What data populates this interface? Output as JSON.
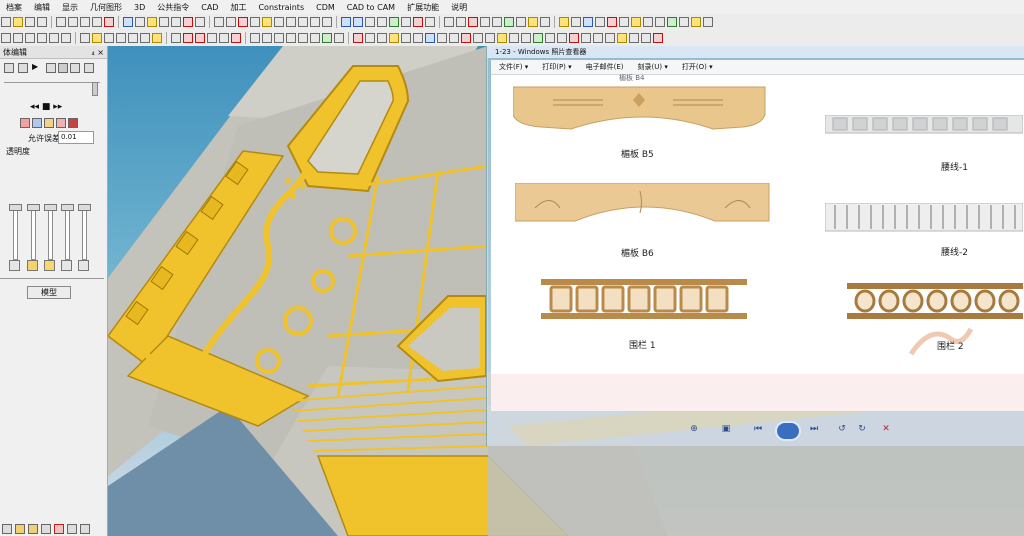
{
  "menu": [
    "档案",
    "编辑",
    "显示",
    "几何图形",
    "3D",
    "公共指令",
    "CAD",
    "加工",
    "Constraints",
    "CDM",
    "CAD to CAM",
    "扩展功能",
    "说明"
  ],
  "panel": {
    "title": "体编辑",
    "pin": "₄",
    "close": "×",
    "tolerance_label": "允许误差",
    "tolerance_value": "0.01",
    "transparency_label": "透明度",
    "apply_button": "模型"
  },
  "viewer": {
    "title": "1-23 - Windows 照片查看器",
    "menu": [
      "文件(F) ▾",
      "打印(P) ▾",
      "电子邮件(E)",
      "刻录(U) ▾",
      "打开(O) ▾"
    ],
    "captions": {
      "top_cut": "楣板 B4",
      "b5": "楣板 B5",
      "b6": "楣板 B6",
      "waist1": "腰线-1",
      "waist2": "腰线-2",
      "rail1": "围栏 1",
      "rail2": "围栏 2"
    }
  },
  "colors": {
    "model_gold": "#f0c32c",
    "model_edge": "#b48a10",
    "plate_grey": "#c4c4bc",
    "sky_top": "#3f90bd",
    "wood": "#e8c68c"
  },
  "icons": [
    "zoom-icon",
    "fit-icon",
    "prev-icon",
    "slideshow-icon",
    "next-icon",
    "rotate-left-icon",
    "rotate-right-icon",
    "delete-icon"
  ]
}
